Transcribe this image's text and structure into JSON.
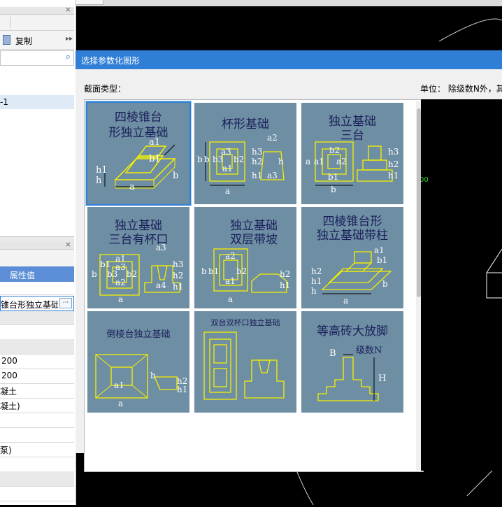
{
  "left_panel": {
    "copy_label": "复制",
    "tree_item": "-1",
    "prop_header": "属性值",
    "prop_value": "锥台形独立基础",
    "rows": [
      "200",
      "200",
      "凝土",
      "凝土)",
      "",
      "",
      "泵)"
    ]
  },
  "dialog": {
    "title": "选择参数化图形",
    "section_label": "截面类型：",
    "unit_label": "单位：  除级数N外，其"
  },
  "shapes": [
    {
      "l1": "四棱锥台",
      "l2": "形独立基础"
    },
    {
      "l1": "杯形基础",
      "l2": ""
    },
    {
      "l1": "独立基础",
      "l2": "三台"
    },
    {
      "l1": "独立基础",
      "l2": "三台有杯口"
    },
    {
      "l1": "独立基础",
      "l2": "双层带坡"
    },
    {
      "l1": "四棱锥台形",
      "l2": "独立基础带柱"
    },
    {
      "l1": "倒棱台独立基础",
      "l2": ""
    },
    {
      "l1": "双台双杯口独立基础",
      "l2": ""
    },
    {
      "l1": "等高砖大放脚",
      "l2": ""
    }
  ],
  "dims": {
    "c1": [
      "a1",
      "b1",
      "h1",
      "h",
      "a",
      "b"
    ],
    "c2": [
      "a2",
      "b",
      "b",
      "b3",
      "a3",
      "b2",
      "h3",
      "h2",
      "h",
      "h1",
      "a1",
      "a3",
      "a"
    ],
    "c3": [
      "b2",
      "a2",
      "a",
      "a1",
      "b1",
      "h3",
      "h2",
      "h1",
      "b"
    ],
    "c4": [
      "a3",
      "a1",
      "b1",
      "a3",
      "b",
      "b3",
      "b2",
      "a2",
      "h3",
      "h2",
      "h1",
      "a4",
      "a"
    ],
    "c5": [
      "a2",
      "b",
      "b1",
      "b2",
      "a1",
      "h2",
      "h1",
      "a"
    ],
    "c6": [
      "a1",
      "b1",
      "h2",
      "h1",
      "h",
      "b",
      "a"
    ],
    "c7": [
      "b",
      "a1",
      "h2",
      "h1",
      "a"
    ],
    "c9": [
      "B",
      "级数N",
      "H"
    ]
  },
  "colors": {
    "accent": "#2f7fd6",
    "tile": "#6e8ea3",
    "drawing": "#f5f000"
  }
}
